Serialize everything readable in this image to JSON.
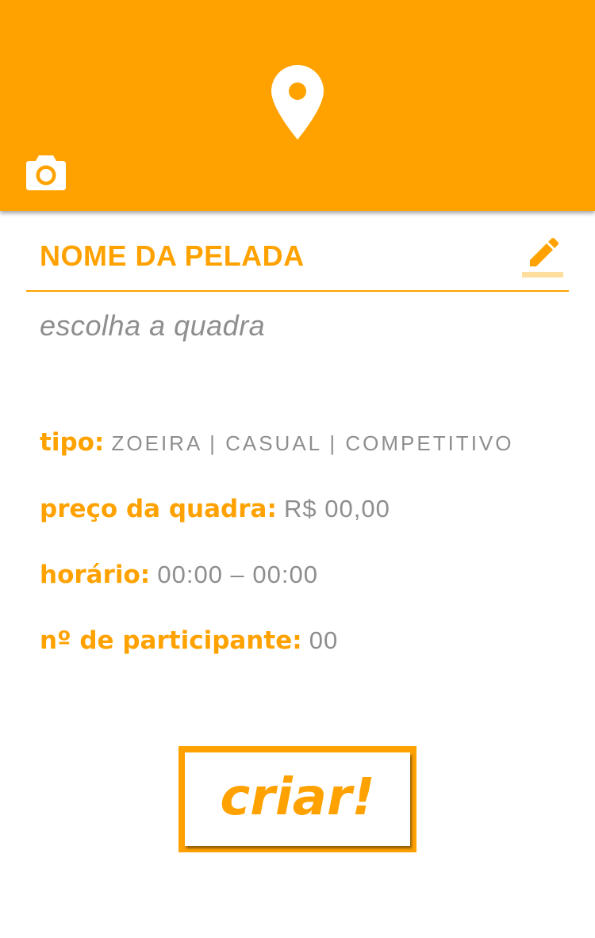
{
  "colors": {
    "accent": "#FFA200",
    "muted_text": "#8e8e8e",
    "background": "#ffffff"
  },
  "header": {
    "pin_icon": "location-pin-icon",
    "camera_icon": "camera-icon"
  },
  "form": {
    "name_title": "NOME DA PELADA",
    "edit_icon": "pencil-icon",
    "court_placeholder": "escolha a quadra",
    "type": {
      "label": "tipo:",
      "options": [
        "zoeira",
        "casual",
        "competitivo"
      ],
      "separator": " | "
    },
    "price": {
      "label": "preço da quadra:",
      "value": "R$ 00,00"
    },
    "time": {
      "label": "horário:",
      "value": "00:00 – 00:00"
    },
    "participants": {
      "label": "nº de participante:",
      "value": "00"
    }
  },
  "actions": {
    "create_label": "criar!"
  }
}
